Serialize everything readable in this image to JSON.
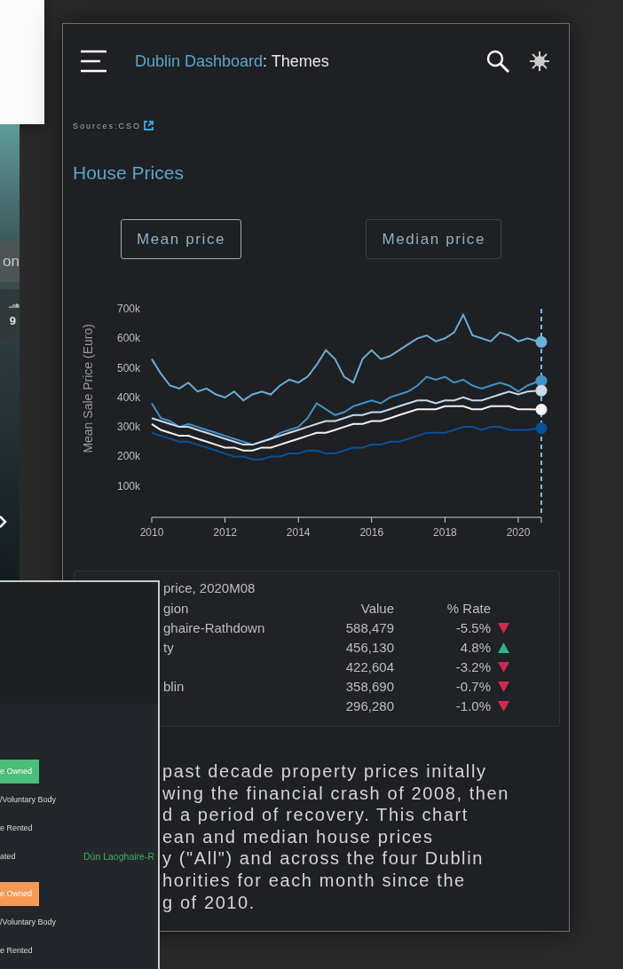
{
  "back_screen": {
    "bar_text": "on",
    "count": "9"
  },
  "app": {
    "brand": "Dublin Dashboard",
    "title": ": Themes",
    "sources": "Sources:CSO",
    "heading": "House Prices",
    "toggle": [
      {
        "label": "Mean price",
        "selected": true
      },
      {
        "label": "Median price",
        "selected": false
      }
    ],
    "chart_data": {
      "type": "line",
      "ylabel": "Mean Sale Price (Euro)",
      "x": [
        2010,
        2010.25,
        2010.5,
        2010.75,
        2011,
        2011.25,
        2011.5,
        2011.75,
        2012,
        2012.25,
        2012.5,
        2012.75,
        2013,
        2013.25,
        2013.5,
        2013.75,
        2014,
        2014.25,
        2014.5,
        2014.75,
        2015,
        2015.25,
        2015.5,
        2015.75,
        2016,
        2016.25,
        2016.5,
        2016.75,
        2017,
        2017.25,
        2017.5,
        2017.75,
        2018,
        2018.25,
        2018.5,
        2018.75,
        2019,
        2019.25,
        2019.5,
        2019.75,
        2020,
        2020.25,
        2020.58
      ],
      "series": [
        {
          "color": "#6baed6",
          "values": [
            530,
            480,
            440,
            430,
            450,
            420,
            430,
            410,
            400,
            420,
            390,
            410,
            420,
            410,
            440,
            460,
            450,
            470,
            510,
            560,
            530,
            470,
            450,
            530,
            560,
            530,
            540,
            560,
            580,
            600,
            610,
            590,
            600,
            620,
            680,
            610,
            600,
            590,
            620,
            610,
            590,
            600,
            588
          ]
        },
        {
          "color": "#4292c6",
          "values": [
            380,
            330,
            320,
            300,
            310,
            300,
            290,
            280,
            270,
            260,
            250,
            240,
            250,
            260,
            280,
            290,
            300,
            330,
            380,
            360,
            340,
            350,
            370,
            380,
            390,
            380,
            400,
            410,
            420,
            440,
            470,
            460,
            470,
            450,
            460,
            440,
            430,
            440,
            450,
            440,
            420,
            440,
            456
          ]
        },
        {
          "color": "#c6dbef",
          "values": [
            330,
            320,
            310,
            300,
            300,
            290,
            280,
            270,
            260,
            250,
            240,
            240,
            250,
            260,
            270,
            280,
            290,
            300,
            310,
            320,
            320,
            330,
            340,
            340,
            350,
            350,
            360,
            370,
            380,
            390,
            390,
            380,
            390,
            390,
            400,
            390,
            390,
            400,
            410,
            420,
            410,
            420,
            423
          ]
        },
        {
          "color": "#f4f4f4",
          "values": [
            310,
            290,
            280,
            270,
            270,
            260,
            250,
            240,
            230,
            230,
            220,
            220,
            230,
            230,
            240,
            250,
            260,
            270,
            280,
            280,
            290,
            300,
            310,
            310,
            320,
            320,
            330,
            340,
            350,
            360,
            360,
            360,
            370,
            370,
            370,
            360,
            360,
            370,
            370,
            370,
            360,
            360,
            359
          ]
        },
        {
          "color": "#08519c",
          "values": [
            280,
            270,
            260,
            250,
            250,
            240,
            230,
            220,
            210,
            200,
            200,
            190,
            190,
            200,
            200,
            210,
            210,
            220,
            220,
            210,
            210,
            220,
            230,
            230,
            240,
            240,
            250,
            250,
            260,
            270,
            280,
            280,
            280,
            290,
            300,
            300,
            290,
            300,
            300,
            290,
            290,
            290,
            296
          ]
        }
      ],
      "xlim": [
        2010,
        2020.63
      ],
      "ylim": [
        0,
        700
      ],
      "xticks": [
        2010,
        2012,
        2014,
        2016,
        2018,
        2020
      ],
      "yticks": [
        {
          "value": 100,
          "label": "100k"
        },
        {
          "value": 200,
          "label": "200k"
        },
        {
          "value": 300,
          "label": "300k"
        },
        {
          "value": 400,
          "label": "400k"
        },
        {
          "value": 500,
          "label": "500k"
        },
        {
          "value": 600,
          "label": "600k"
        },
        {
          "value": 700,
          "label": "700k"
        }
      ]
    },
    "table": {
      "title": "price, 2020M08",
      "columns": [
        "gion",
        "Value",
        "% Rate"
      ],
      "rows": [
        {
          "region": "ghaire-Rathdown",
          "value": "588,479",
          "rate": "-5.5%",
          "rising": false
        },
        {
          "region": "ty",
          "value": "456,130",
          "rate": "4.8%",
          "rising": true
        },
        {
          "value": "422,604",
          "rate": "-3.2%",
          "rising": false
        },
        {
          "region": "blin",
          "value": "358,690",
          "rate": "-0.7%",
          "rising": false
        },
        {
          "value": "296,280",
          "rate": "-1.0%",
          "rising": false
        }
      ]
    },
    "description": [
      "past decade property prices initally",
      "wing the financial crash of 2008, then",
      "d a period of recovery. This chart",
      "ean and median house prices",
      "y (\"All\") and across the four Dublin",
      "horities for each month since the",
      "g of 2010."
    ]
  },
  "side_panel": {
    "items": [
      {
        "kind": "bar",
        "label": "e Owned",
        "color": "#4cbc7a"
      },
      {
        "kind": "text",
        "label": "/Voluntary Body"
      },
      {
        "kind": "text",
        "label": "e Rented"
      },
      {
        "kind": "text",
        "label": "ated",
        "note": "Dún Laoghaire-R"
      },
      {
        "kind": "bar",
        "label": "e Owned",
        "color": "#f59a55"
      },
      {
        "kind": "text",
        "label": "/Voluntary Body"
      },
      {
        "kind": "text",
        "label": "e Rented"
      }
    ]
  }
}
